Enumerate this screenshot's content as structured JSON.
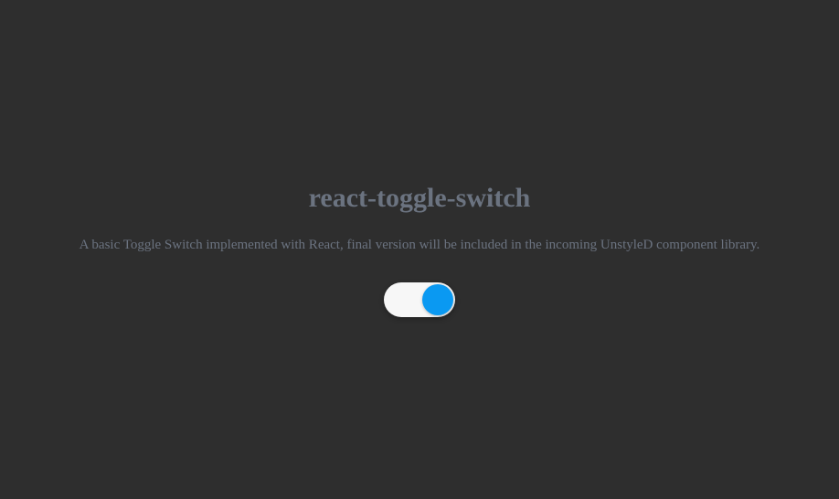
{
  "main": {
    "title": "react-toggle-switch",
    "description": "A basic Toggle Switch implemented with React, final version will be included in the incoming UnstyleD component library.",
    "toggle_state": "on"
  }
}
